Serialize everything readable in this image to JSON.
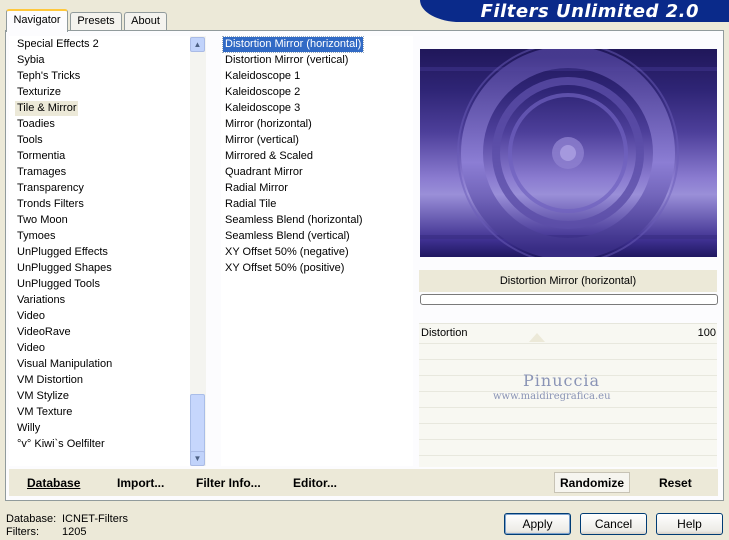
{
  "header": {
    "title": "Filters Unlimited 2.0"
  },
  "tabs": [
    {
      "label": "Navigator",
      "active": true
    },
    {
      "label": "Presets",
      "active": false
    },
    {
      "label": "About",
      "active": false
    }
  ],
  "categories": [
    "Special Effects 2",
    "Sybia",
    "Teph's Tricks",
    "Texturize",
    "Tile & Mirror",
    "Toadies",
    "Tools",
    "Tormentia",
    "Tramages",
    "Transparency",
    "Tronds Filters",
    "Two Moon",
    "Tymoes",
    "UnPlugged Effects",
    "UnPlugged Shapes",
    "UnPlugged Tools",
    "Variations",
    "Video",
    "VideoRave",
    "Video",
    "Visual Manipulation",
    "VM Distortion",
    "VM Stylize",
    "VM Texture",
    "Willy",
    "°v° Kiwi`s Oelfilter"
  ],
  "selected_category": "Tile & Mirror",
  "filters": [
    "Distortion Mirror (horizontal)",
    "Distortion Mirror (vertical)",
    "Kaleidoscope 1",
    "Kaleidoscope 2",
    "Kaleidoscope 3",
    "Mirror (horizontal)",
    "Mirror (vertical)",
    "Mirrored & Scaled",
    "Quadrant Mirror",
    "Radial Mirror",
    "Radial Tile",
    "Seamless Blend (horizontal)",
    "Seamless Blend (vertical)",
    "XY Offset 50% (negative)",
    "XY Offset 50% (positive)"
  ],
  "selected_filter": "Distortion Mirror (horizontal)",
  "filter_name_display": "Distortion Mirror (horizontal)",
  "params": [
    {
      "label": "Distortion",
      "value": "100"
    }
  ],
  "watermark": {
    "line1": "Pinuccia",
    "line2": "www.maidiregrafica.eu"
  },
  "bottom_bar": {
    "database_label": "Database",
    "import_label": "Import...",
    "filter_info_label": "Filter Info...",
    "editor_label": "Editor...",
    "randomize_label": "Randomize",
    "reset_label": "Reset"
  },
  "status": {
    "database_key": "Database:",
    "database_value": "ICNET-Filters",
    "filters_key": "Filters:",
    "filters_value": "1205"
  },
  "buttons": {
    "apply": "Apply",
    "cancel": "Cancel",
    "help": "Help"
  },
  "colors": {
    "banner": "#0a2a8a",
    "selection": "#316ac5",
    "tab_highlight": "#ffc83c"
  },
  "scrollbar": {
    "up_icon": "chevron-up-icon",
    "down_icon": "chevron-down-icon"
  }
}
